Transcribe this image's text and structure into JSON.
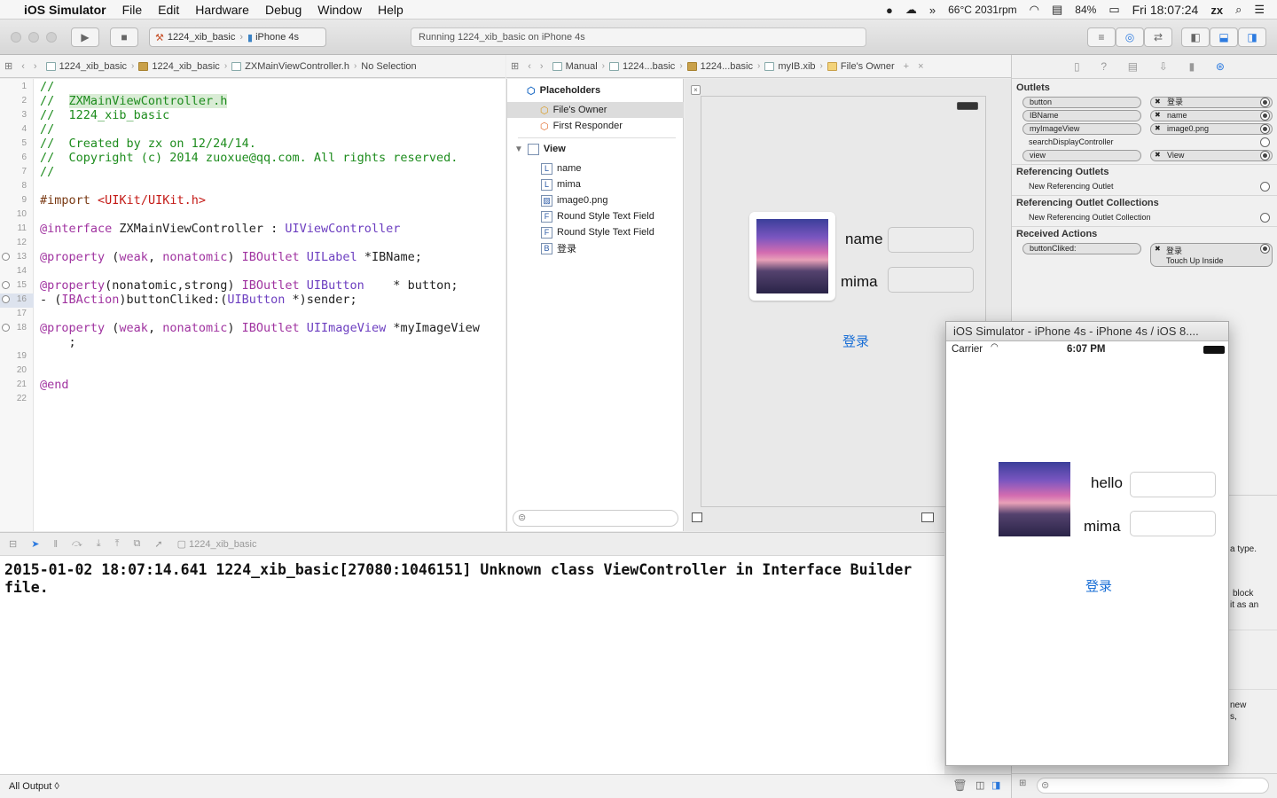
{
  "menubar": {
    "app": "iOS Simulator",
    "items": [
      "File",
      "Edit",
      "Hardware",
      "Debug",
      "Window",
      "Help"
    ],
    "temp": "66°C 2031rpm",
    "battery": "84%",
    "clock": "Fri 18:07:24",
    "user": "zx"
  },
  "toolbar": {
    "scheme": "1224_xib_basic",
    "device": "iPhone 4s",
    "status": "Running 1224_xib_basic on iPhone 4s"
  },
  "jump_left": [
    "1224_xib_basic",
    "1224_xib_basic",
    "ZXMainViewController.h",
    "No Selection"
  ],
  "jump_right": [
    "Manual",
    "1224...basic",
    "1224...basic",
    "myIB.xib",
    "File's Owner"
  ],
  "code": {
    "line_numbers": [
      "1",
      "2",
      "3",
      "4",
      "5",
      "6",
      "7",
      "8",
      "9",
      "10",
      "11",
      "12",
      "13",
      "14",
      "15",
      "16",
      "17",
      "18",
      "",
      "19",
      "20",
      "21",
      "22"
    ],
    "l1": "//",
    "l2_prefix": "//  ",
    "l2_file": "ZXMainViewController.h",
    "l3": "//  1224_xib_basic",
    "l4": "//",
    "l5": "//  Created by zx on 12/24/14.",
    "l6": "//  Copyright (c) 2014 zuoxue@qq.com. All rights reserved.",
    "l7": "//",
    "import_kw": "#import",
    "import_val": "<UIKit/UIKit.h>",
    "iface_kw": "@interface",
    "iface_name": " ZXMainViewController : ",
    "iface_super": "UIViewController",
    "p1_kw": "@property",
    "p1_a": " (",
    "p1_b": "weak",
    "p1_c": ", ",
    "p1_d": "nonatomic",
    "p1_e": ") ",
    "p1_f": "IBOutlet",
    "p1_g": " ",
    "p1_h": "UILabel",
    "p1_i": " *IBName;",
    "p2_kw": "@property",
    "p2_a": "(nonatomic,strong) ",
    "p2_b": "IBOutlet",
    "p2_c": " ",
    "p2_d": "UIButton",
    "p2_e": "    * button;",
    "m1_a": "- (",
    "m1_b": "IBAction",
    "m1_c": ")buttonCliked:(",
    "m1_d": "UIButton",
    "m1_e": " *)sender;",
    "p3_kw": "@property",
    "p3_a": " (",
    "p3_b": "weak",
    "p3_c": ", ",
    "p3_d": "nonatomic",
    "p3_e": ") ",
    "p3_f": "IBOutlet",
    "p3_g": " ",
    "p3_h": "UIImageView",
    "p3_i": " *myImageView",
    "p3_cont": "    ;",
    "end_kw": "@end"
  },
  "outline": {
    "placeholders": "Placeholders",
    "files_owner": "File's Owner",
    "first_responder": "First Responder",
    "view": "View",
    "items": [
      {
        "badge": "L",
        "label": "name"
      },
      {
        "badge": "L",
        "label": "mima"
      },
      {
        "badge": "",
        "label": "image0.png"
      },
      {
        "badge": "F",
        "label": "Round Style Text Field"
      },
      {
        "badge": "F",
        "label": "Round Style Text Field"
      },
      {
        "badge": "B",
        "label": "登录"
      }
    ]
  },
  "ib_canvas": {
    "name_label": "name",
    "mima_label": "mima",
    "login": "登录"
  },
  "inspector": {
    "outlets_title": "Outlets",
    "outlets": [
      {
        "name": "button",
        "target": "登录"
      },
      {
        "name": "IBName",
        "target": "name"
      },
      {
        "name": "myImageView",
        "target": "image0.png"
      },
      {
        "name": "searchDisplayController",
        "target": ""
      },
      {
        "name": "view",
        "target": "View"
      }
    ],
    "ref_outlets_title": "Referencing Outlets",
    "new_ref_outlet": "New Referencing Outlet",
    "ref_coll_title": "Referencing Outlet Collections",
    "new_ref_coll": "New Referencing Outlet Collection",
    "actions_title": "Received Actions",
    "action_name": "buttonCliked:",
    "action_target": "登录",
    "action_event": "Touch Up Inside",
    "frag1": "a type.",
    "frag2": "block",
    "frag3": "it as an",
    "frag4": "new",
    "frag5": "s,"
  },
  "debug": {
    "target": "1224_xib_basic",
    "console": "2015-01-02 18:07:14.641 1224_xib_basic[27080:1046151] Unknown class ViewController in Interface Builder\nfile.",
    "filter": "All Output ◊"
  },
  "simulator": {
    "title": "iOS Simulator - iPhone 4s - iPhone 4s / iOS 8....",
    "carrier": "Carrier",
    "time": "6:07 PM",
    "hello": "hello",
    "mima": "mima",
    "login": "登录"
  },
  "colors": {
    "link_blue": "#1a6fd6",
    "comment_green": "#1d8c1d",
    "keyword_purple": "#a033a0"
  }
}
